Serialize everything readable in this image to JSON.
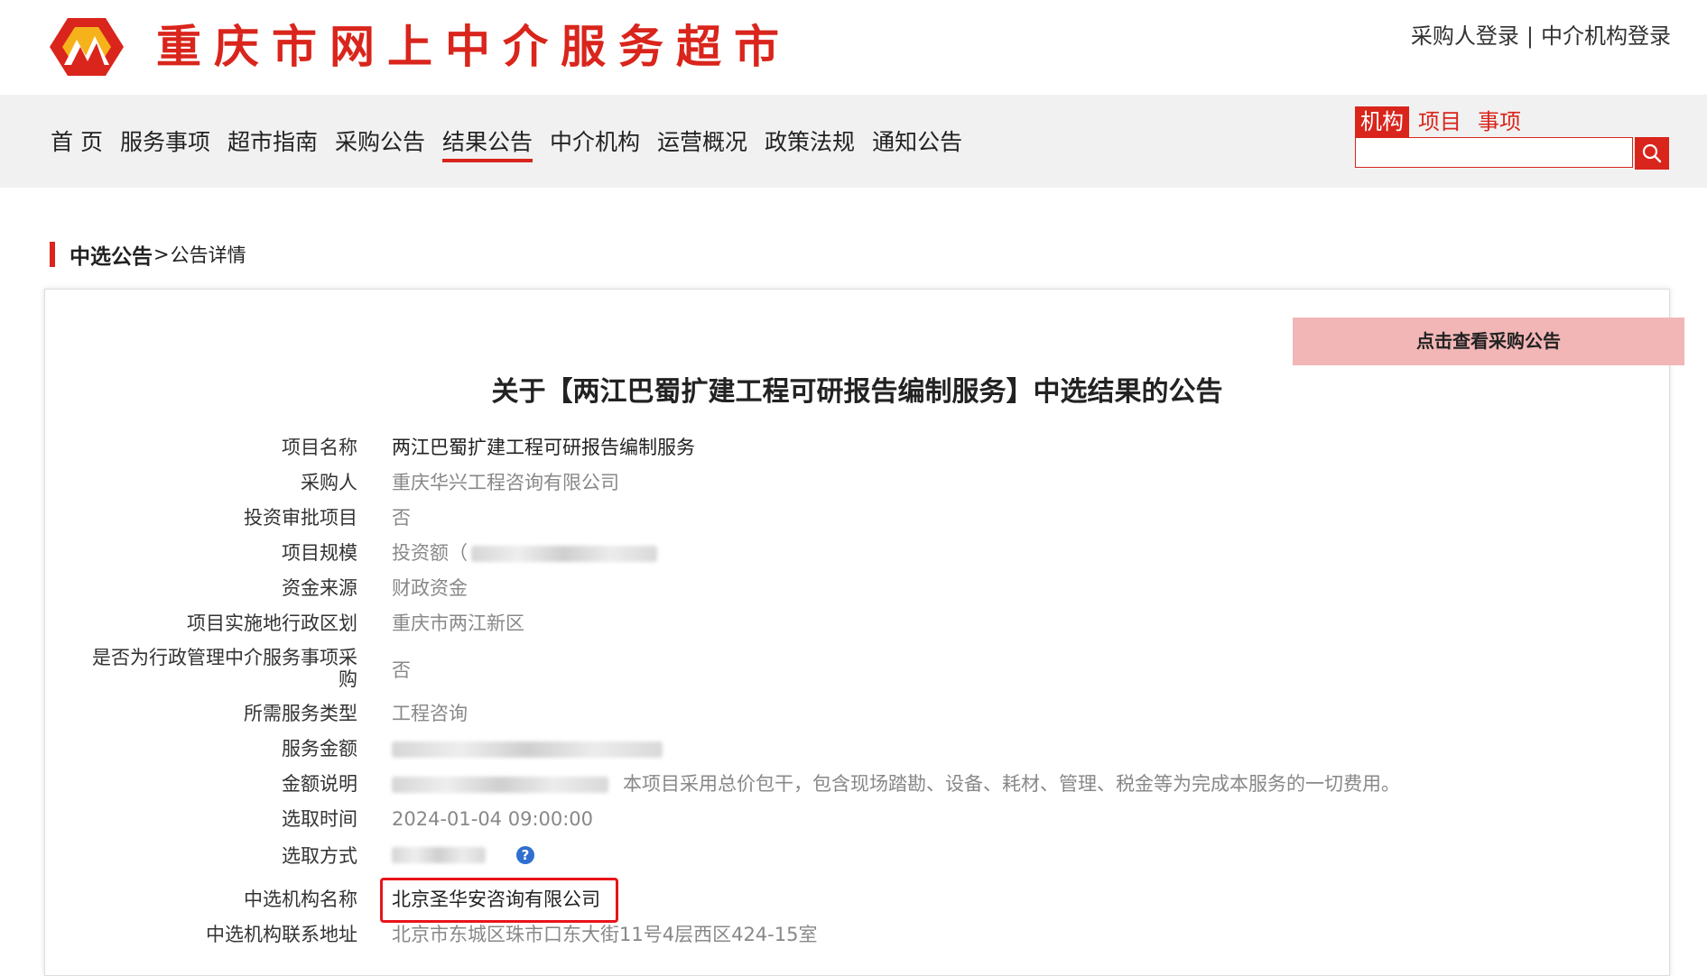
{
  "header": {
    "site_title": "重庆市网上中介服务超市",
    "buyer_login": "采购人登录",
    "separator": "|",
    "agency_login": "中介机构登录",
    "accent_color": "#d9251c"
  },
  "nav": {
    "items": [
      {
        "label": "首 页"
      },
      {
        "label": "服务事项"
      },
      {
        "label": "超市指南"
      },
      {
        "label": "采购公告"
      },
      {
        "label": "结果公告",
        "active": true
      },
      {
        "label": "中介机构"
      },
      {
        "label": "运营概况"
      },
      {
        "label": "政策法规"
      },
      {
        "label": "通知公告"
      }
    ]
  },
  "search": {
    "tabs": [
      {
        "label": "机构",
        "active": true
      },
      {
        "label": "项目"
      },
      {
        "label": "事项"
      }
    ],
    "value": "",
    "icon": "search-icon"
  },
  "breadcrumb": {
    "main": "中选公告",
    "separator": ">",
    "sub": "公告详情"
  },
  "announcement": {
    "view_button": "点击查看采购公告",
    "title": "关于【两江巴蜀扩建工程可研报告编制服务】中选结果的公告",
    "fields": {
      "project_name": {
        "label": "项目名称",
        "value": "两江巴蜀扩建工程可研报告编制服务"
      },
      "purchaser": {
        "label": "采购人",
        "value": "重庆华兴工程咨询有限公司"
      },
      "investment_review": {
        "label": "投资审批项目",
        "value": "否"
      },
      "project_scale": {
        "label": "项目规模",
        "value": "投资额（"
      },
      "fund_source": {
        "label": "资金来源",
        "value": "财政资金"
      },
      "region": {
        "label": "项目实施地行政区划",
        "value": "重庆市两江新区"
      },
      "admin_service": {
        "label": "是否为行政管理中介服务事项采购",
        "value": "否"
      },
      "service_type": {
        "label": "所需服务类型",
        "value": "工程咨询"
      },
      "service_amount": {
        "label": "服务金额",
        "value": ""
      },
      "amount_note": {
        "label": "金额说明",
        "value": "本项目采用总价包干，包含现场踏勘、设备、耗材、管理、税金等为完成本服务的一切费用。"
      },
      "select_time": {
        "label": "选取时间",
        "value": "2024-01-04 09:00:00"
      },
      "select_method": {
        "label": "选取方式",
        "value": ""
      },
      "winner_name": {
        "label": "中选机构名称",
        "value": "北京圣华安咨询有限公司"
      },
      "winner_address": {
        "label": "中选机构联系地址",
        "value": "北京市东城区珠市口东大街11号4层西区424-15室"
      }
    }
  }
}
